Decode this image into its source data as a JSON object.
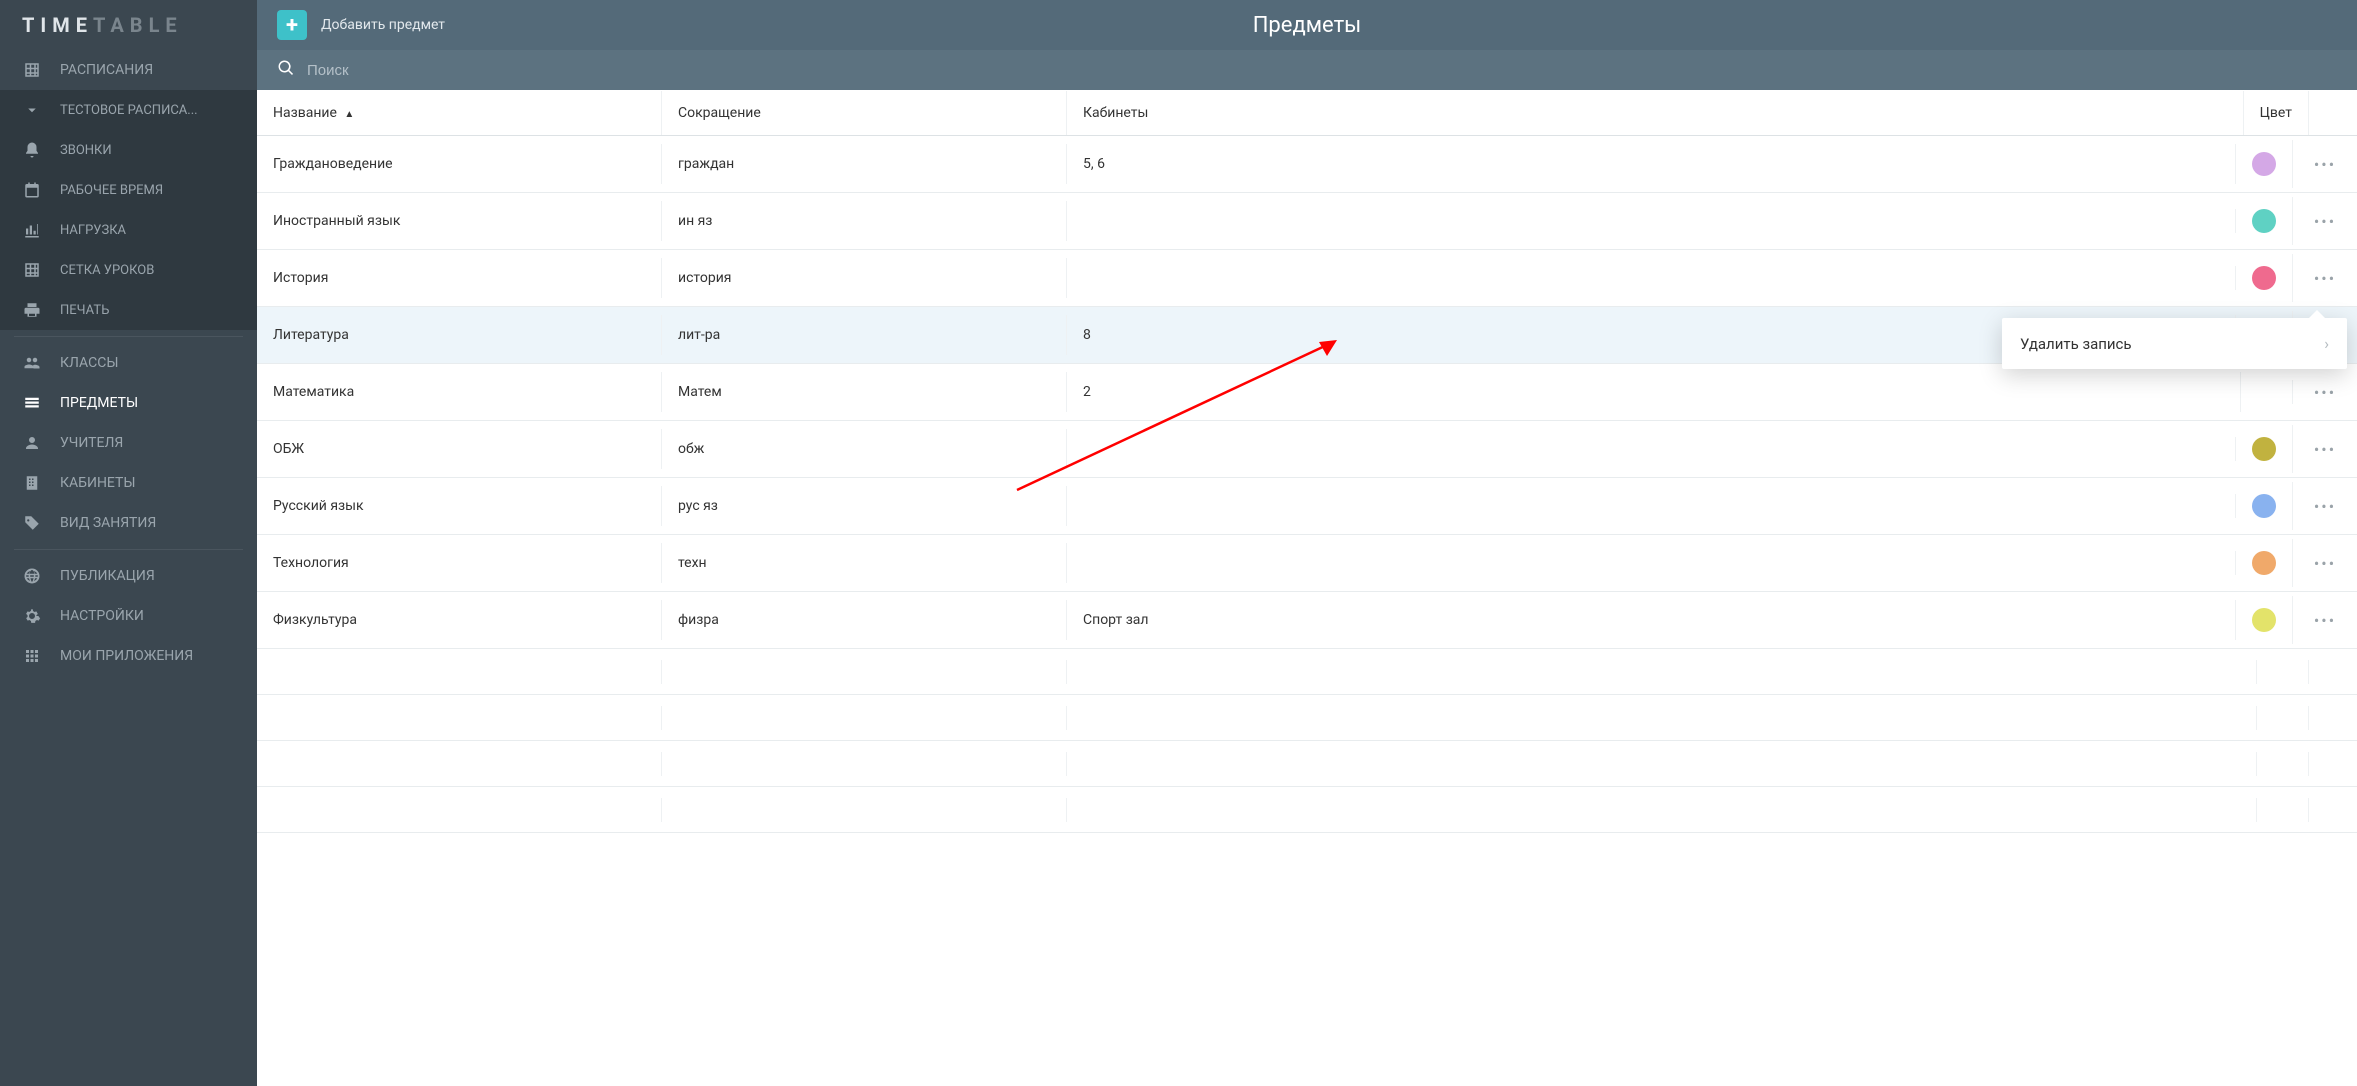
{
  "logo_light": "TIME",
  "logo_dark": "TABLE",
  "header": {
    "add_label": "Добавить предмет",
    "title": "Предметы"
  },
  "search": {
    "placeholder": "Поиск"
  },
  "sidebar": {
    "schedules": "РАСПИСАНИЯ",
    "test_schedule": "ТЕСТОВОЕ РАСПИСА...",
    "bells": "ЗВОНКИ",
    "work_time": "РАБОЧЕЕ ВРЕМЯ",
    "load": "НАГРУЗКА",
    "grid": "СЕТКА УРОКОВ",
    "print": "ПЕЧАТЬ",
    "classes": "КЛАССЫ",
    "subjects": "ПРЕДМЕТЫ",
    "teachers": "УЧИТЕЛЯ",
    "rooms": "КАБИНЕТЫ",
    "activity_type": "ВИД ЗАНЯТИЯ",
    "publication": "ПУБЛИКАЦИЯ",
    "settings": "НАСТРОЙКИ",
    "my_apps": "МОИ ПРИЛОЖЕНИЯ"
  },
  "table": {
    "head_name": "Название",
    "head_abbr": "Сокращение",
    "head_cab": "Кабинеты",
    "head_color": "Цвет",
    "sort_indicator": "▲",
    "rows": [
      {
        "name": "Граждановедение",
        "abbr": "граждан",
        "cab": "5, 6",
        "color": "#d4a8e6"
      },
      {
        "name": "Иностранный язык",
        "abbr": "ин яз",
        "cab": "",
        "color": "#5fd1c3"
      },
      {
        "name": "История",
        "abbr": "история",
        "cab": "",
        "color": "#ef6a8e"
      },
      {
        "name": "Литература",
        "abbr": "лит-ра",
        "cab": "8",
        "color": "#e3808c"
      },
      {
        "name": "Математика",
        "abbr": "Матем",
        "cab": "2",
        "color": ""
      },
      {
        "name": "ОБЖ",
        "abbr": "обж",
        "cab": "",
        "color": "#c1b23f"
      },
      {
        "name": "Русский язык",
        "abbr": "рус яз",
        "cab": "",
        "color": "#89b2ef"
      },
      {
        "name": "Технология",
        "abbr": "техн",
        "cab": "",
        "color": "#f0a96a"
      },
      {
        "name": "Физкультура",
        "abbr": "физра",
        "cab": "Спорт зал",
        "color": "#e3e36a"
      }
    ],
    "selected_index": 3
  },
  "ctx_menu": {
    "delete": "Удалить запись"
  }
}
